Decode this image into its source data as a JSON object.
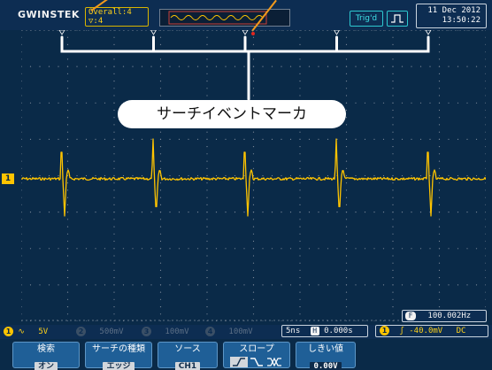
{
  "header": {
    "brand": "GWINSTEK",
    "overall_line1": "Overall:4",
    "overall_line2": "▽:4",
    "trigger_status": "Trig'd",
    "date": "11 Dec 2012",
    "time": "13:50:22"
  },
  "annotation": {
    "bracket_label": "サーチイベントマーカ"
  },
  "waveform": {
    "channel_marker": "1",
    "color": "#ffc400",
    "pulse_count": 5
  },
  "status_bar": {
    "ch1_num": "1",
    "ch1_coupling": "∿",
    "ch1_scale": "5V",
    "ch2_num": "2",
    "ch2_scale": "500mV",
    "ch3_num": "3",
    "ch3_scale": "100mV",
    "ch4_num": "4",
    "ch4_scale": "100mV",
    "timebase": "5ns",
    "h_label": "H",
    "h_position": "0.000s",
    "freq_label": "F",
    "frequency": "100.002Hz",
    "trig_src": "1",
    "trig_edge": "ʃ",
    "trig_level": "-40.0mV",
    "trig_coupling": "DC"
  },
  "soft_menu": [
    {
      "title": "検索",
      "value": "オン"
    },
    {
      "title": "サーチの種類",
      "value": "エッジ"
    },
    {
      "title": "ソース",
      "value": "CH1"
    },
    {
      "title": "スロープ",
      "value": ""
    },
    {
      "title": "しきい値",
      "value": "0.00V"
    }
  ],
  "colors": {
    "accent_orange": "#f29a1c",
    "channel1": "#ffd21a",
    "trigger_cyan": "#2ec8d0"
  }
}
